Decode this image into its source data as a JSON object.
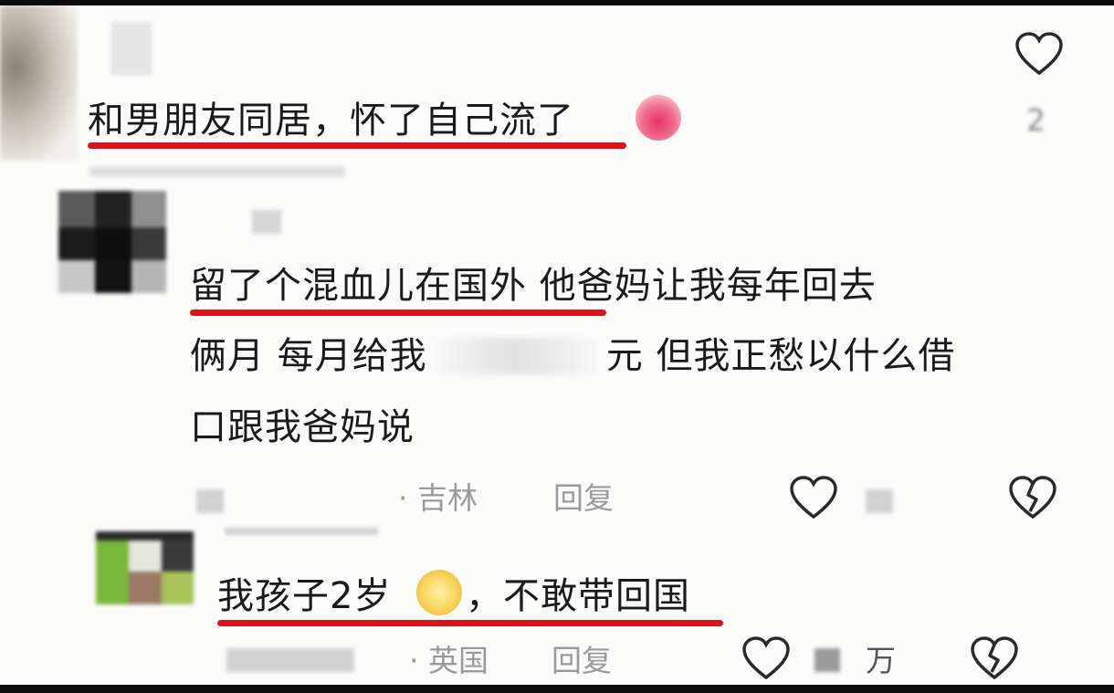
{
  "comment1": {
    "text": "和男朋友同居，怀了自己流了",
    "emoji": "crying-face-emoji",
    "like_count": "2"
  },
  "reply1": {
    "line1_underlined": "留了个混血儿在国外",
    "line1_rest": " 他爸妈让我每年回去",
    "line2_a": "俩月 每月给我",
    "line2_b": "元 但我正愁以什么借",
    "line3": "口跟我爸妈说",
    "location": "· 吉林",
    "reply_label": "回复"
  },
  "reply2": {
    "text_a": "我孩子2岁",
    "text_b": "，不敢带回国",
    "emoji": "grinning-sweat-emoji",
    "location": "· 英国",
    "reply_label": "回复",
    "like_count": "万"
  },
  "colors": {
    "underline": "#d8141c",
    "text": "#1a1a1a",
    "meta": "#9a9a9a"
  }
}
